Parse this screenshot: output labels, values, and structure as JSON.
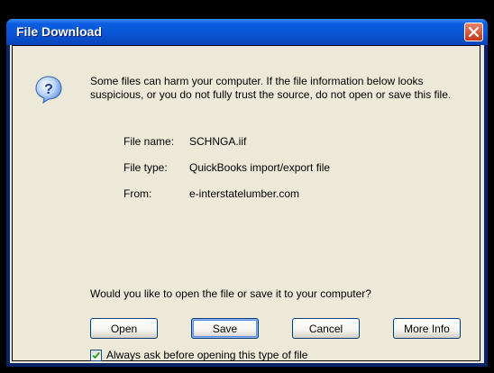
{
  "dialog": {
    "title": "File Download",
    "message": "Some files can harm your computer. If the file information below looks suspicious, or you do not fully trust the source, do not open or save this file.",
    "file_info": {
      "name_label": "File name:",
      "name_value": "SCHNGA.iif",
      "type_label": "File type:",
      "type_value": "QuickBooks import/export file",
      "from_label": "From:",
      "from_value": "e-interstatelumber.com"
    },
    "question": "Would you like to open the file or save it to your computer?",
    "buttons": {
      "open": "Open",
      "save": "Save",
      "cancel": "Cancel",
      "more_info": "More Info"
    },
    "checkbox": {
      "label": "Always ask before opening this type of file",
      "checked": true
    }
  },
  "icons": {
    "title_close": "close-icon",
    "message_icon": "question-icon",
    "checkbox_mark": "checkmark-icon"
  },
  "colors": {
    "titlebar": "#0a54d4",
    "close_button": "#c7361b",
    "client_bg": "#ece9d8",
    "button_border": "#003c74"
  }
}
